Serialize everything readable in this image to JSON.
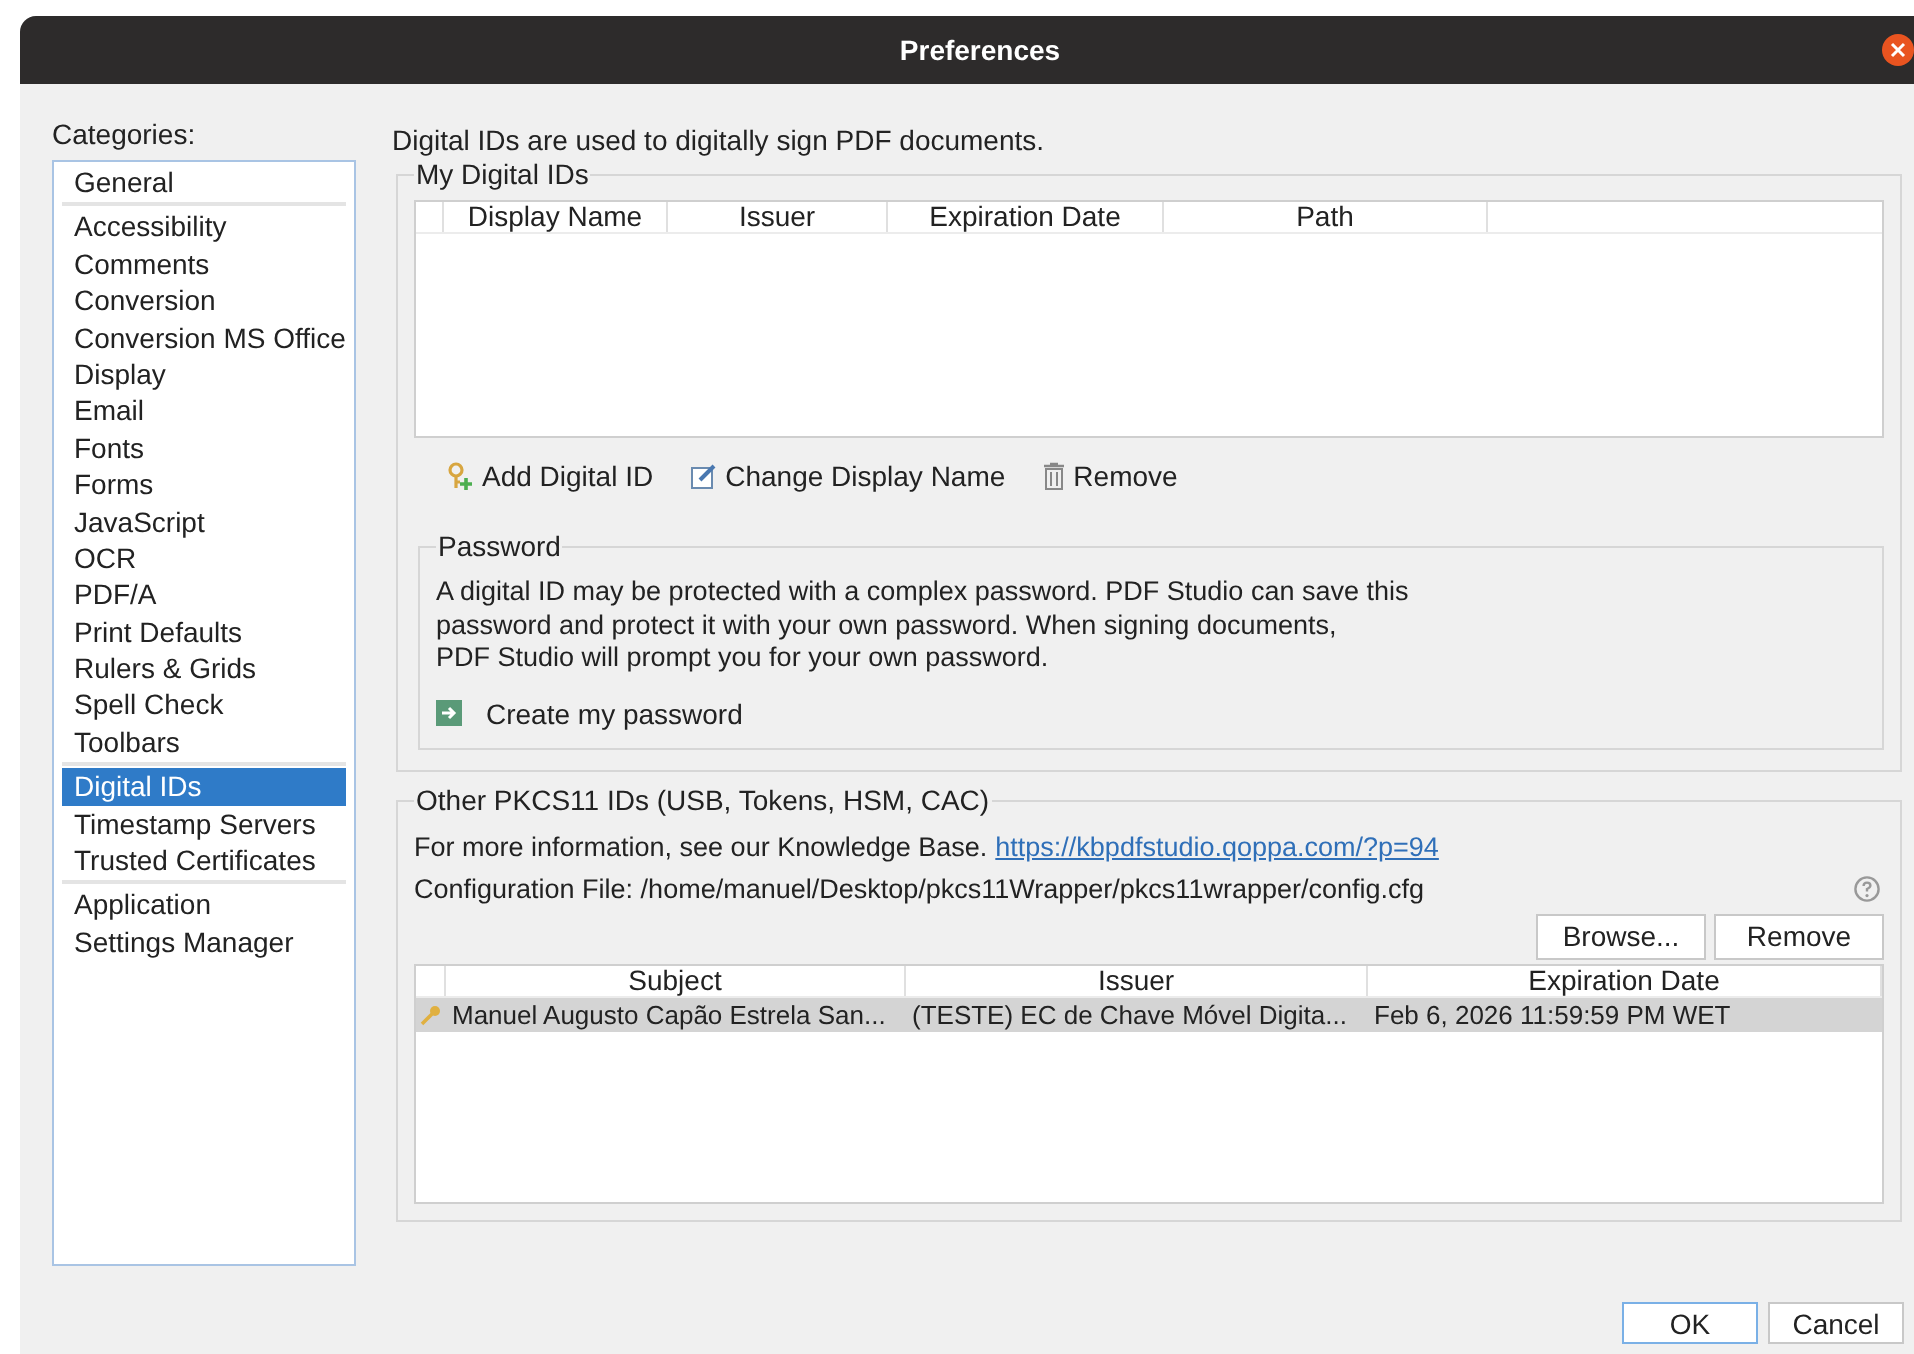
{
  "window": {
    "title": "Preferences"
  },
  "categories": {
    "label": "Categories:",
    "groups": [
      [
        {
          "label": "General",
          "selected": false
        }
      ],
      [
        {
          "label": "Accessibility",
          "selected": false
        },
        {
          "label": "Comments",
          "selected": false
        },
        {
          "label": "Conversion",
          "selected": false
        },
        {
          "label": "Conversion MS Office",
          "selected": false
        },
        {
          "label": "Display",
          "selected": false
        },
        {
          "label": "Email",
          "selected": false
        },
        {
          "label": "Fonts",
          "selected": false
        },
        {
          "label": "Forms",
          "selected": false
        },
        {
          "label": "JavaScript",
          "selected": false
        },
        {
          "label": "OCR",
          "selected": false
        },
        {
          "label": "PDF/A",
          "selected": false
        },
        {
          "label": "Print Defaults",
          "selected": false
        },
        {
          "label": "Rulers & Grids",
          "selected": false
        },
        {
          "label": "Spell Check",
          "selected": false
        },
        {
          "label": "Toolbars",
          "selected": false
        }
      ],
      [
        {
          "label": "Digital IDs",
          "selected": true
        },
        {
          "label": "Timestamp Servers",
          "selected": false
        },
        {
          "label": "Trusted Certificates",
          "selected": false
        }
      ],
      [
        {
          "label": "Application",
          "selected": false
        },
        {
          "label": "Settings Manager",
          "selected": false
        }
      ]
    ]
  },
  "intro": "Digital IDs are used to digitally sign PDF documents.",
  "my_ids": {
    "title": "My Digital IDs",
    "columns": [
      "Display Name",
      "Issuer",
      "Expiration Date",
      "Path"
    ],
    "actions": [
      {
        "label": "Add Digital ID",
        "kind": "add"
      },
      {
        "label": "Change Display Name",
        "kind": "edit"
      },
      {
        "label": "Remove",
        "kind": "remove"
      }
    ]
  },
  "password": {
    "title": "Password",
    "text": "A digital ID may be protected with a complex password. PDF Studio can save this\npassword and protect it with your own password. When signing documents,\nPDF Studio will prompt you for your own password.",
    "action": "Create my password"
  },
  "pkcs11": {
    "title": "Other PKCS11 IDs (USB, Tokens, HSM, CAC)",
    "info": "For more information, see our Knowledge Base.",
    "link": "https://kbpdfstudio.qoppa.com/?p=94",
    "config": "Configuration File: /home/manuel/Desktop/pkcs11Wrapper/pkcs11wrapper/config.cfg",
    "buttons": [
      "Browse...",
      "Remove"
    ],
    "columns": [
      "Subject",
      "Issuer",
      "Expiration Date"
    ],
    "rows": [
      {
        "cells": [
          "Manuel Augusto Capão Estrela San...",
          "(TESTE) EC de Chave Móvel Digita...",
          "Feb 6, 2026 11:59:59 PM WET"
        ],
        "selected": true
      }
    ]
  },
  "footer": [
    {
      "label": "OK",
      "default": true
    },
    {
      "label": "Cancel",
      "default": false
    }
  ]
}
